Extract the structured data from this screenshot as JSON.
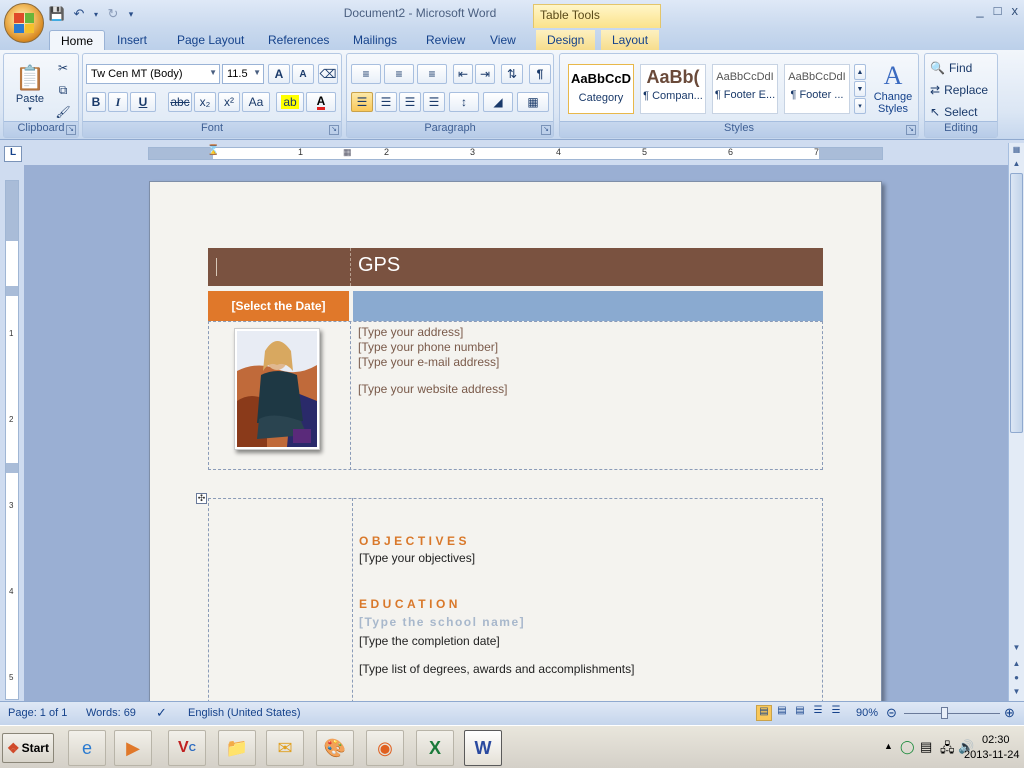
{
  "window": {
    "title": "Document2 - Microsoft Word",
    "contextual_tab": "Table Tools",
    "minimize": "_",
    "maximize": "□",
    "close": "x"
  },
  "tabs": [
    "Home",
    "Insert",
    "Page Layout",
    "References",
    "Mailings",
    "Review",
    "View",
    "Design",
    "Layout"
  ],
  "ribbon": {
    "clipboard": {
      "label": "Clipboard",
      "paste": "Paste"
    },
    "font": {
      "label": "Font",
      "family": "Tw Cen MT (Body)",
      "size": "11.5",
      "bold": "B",
      "italic": "I",
      "underline": "U",
      "strike": "abc",
      "subscript": "x₂",
      "superscript": "x²",
      "change_case": "Aa",
      "grow": "A",
      "shrink": "A"
    },
    "paragraph": {
      "label": "Paragraph",
      "pilcrow": "¶"
    },
    "styles": {
      "label": "Styles",
      "items": [
        {
          "preview": "AaBbCcD",
          "name": "Category"
        },
        {
          "preview": "AaBb(",
          "name": "¶ Compan..."
        },
        {
          "preview": "AaBbCcDdI",
          "name": "¶ Footer E..."
        },
        {
          "preview": "AaBbCcDdI",
          "name": "¶ Footer ..."
        }
      ],
      "change_styles": "Change Styles"
    },
    "editing": {
      "label": "Editing",
      "find": "Find",
      "replace": "Replace",
      "select": "Select"
    }
  },
  "ruler": {
    "numbers": [
      "1",
      "2",
      "3",
      "4",
      "5",
      "6",
      "7"
    ],
    "corner": "L"
  },
  "vruler": {
    "numbers": [
      "1",
      "2",
      "3",
      "4",
      "5"
    ]
  },
  "resume": {
    "name": "GPS",
    "date_placeholder": "[Select the Date]",
    "address": "[Type your address]",
    "phone": "[Type your phone number]",
    "email": "[Type your e-mail address]",
    "website": "[Type your website address]",
    "objectives_heading": "OBJECTIVES",
    "objectives": "[Type your objectives]",
    "education_heading": "EDUCATION",
    "school": "[Type the school name]",
    "completion": "[Type the completion date]",
    "degrees": "[Type list of degrees, awards and accomplishments]"
  },
  "colors": {
    "header_brown": "#7a5240",
    "date_orange": "#e0782a",
    "bar_blue": "#8aaad0",
    "heading_orange": "#d9782a"
  },
  "statusbar": {
    "page": "Page: 1 of 1",
    "words": "Words: 69",
    "language": "English (United States)",
    "zoom": "90%",
    "zoom_level": 0.9
  },
  "taskbar": {
    "start": "Start",
    "time": "02:30",
    "date": "2013-11-24"
  }
}
